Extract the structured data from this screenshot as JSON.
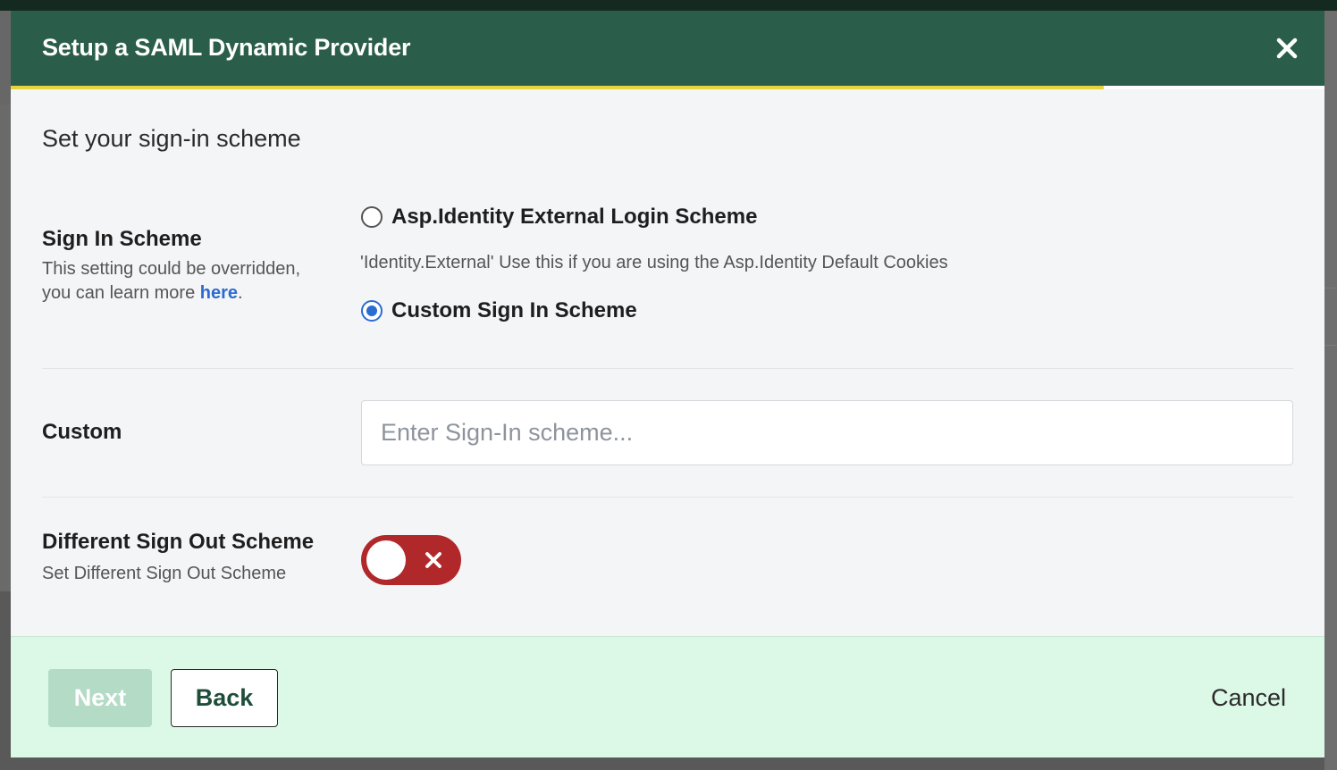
{
  "modal": {
    "title": "Setup a SAML Dynamic Provider",
    "progress_fraction": 0.832,
    "colors": {
      "header": "#2b5e4a",
      "progress": "#e9d33c",
      "footer": "#dcf8e7",
      "toggle_off": "#b1282b",
      "link": "#2c6bd1"
    }
  },
  "content": {
    "heading": "Set your sign-in scheme",
    "sign_in": {
      "label": "Sign In Scheme",
      "description_text": "This setting could be overridden, you can learn more ",
      "link_text": "here",
      "description_end": ".",
      "options": [
        {
          "label": "Asp.Identity External Login Scheme",
          "checked": false
        },
        {
          "label": "Custom Sign In Scheme",
          "checked": true
        }
      ],
      "option_help": "'Identity.External' Use this if you are using the Asp.Identity Default Cookies"
    },
    "custom": {
      "label": "Custom",
      "value": "",
      "placeholder": "Enter Sign-In scheme..."
    },
    "sign_out": {
      "label": "Different Sign Out Scheme",
      "description": "Set Different Sign Out Scheme",
      "toggle_on": false
    }
  },
  "footer": {
    "next_label": "Next",
    "back_label": "Back",
    "cancel_label": "Cancel"
  },
  "icons": {
    "close": "close-icon",
    "toggle": "x-icon"
  }
}
